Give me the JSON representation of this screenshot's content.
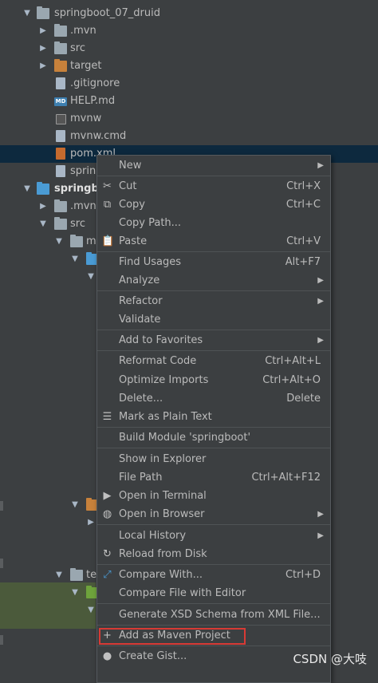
{
  "tree": {
    "items": [
      {
        "label": "springboot_07_druid"
      },
      {
        "label": ".mvn"
      },
      {
        "label": "src"
      },
      {
        "label": "target"
      },
      {
        "label": ".gitignore"
      },
      {
        "label": "HELP.md",
        "badge": "MD"
      },
      {
        "label": "mvnw"
      },
      {
        "label": "mvnw.cmd"
      },
      {
        "label": "pom.xml"
      },
      {
        "label": "sprin"
      },
      {
        "label": "springbo"
      },
      {
        "label": ".mvn"
      },
      {
        "label": "src"
      },
      {
        "label": "m"
      },
      {
        "label": "te"
      }
    ]
  },
  "menu": {
    "items": [
      {
        "label": "New"
      },
      {
        "label": "Cut",
        "shortcut": "Ctrl+X"
      },
      {
        "label": "Copy",
        "shortcut": "Ctrl+C"
      },
      {
        "label": "Copy Path..."
      },
      {
        "label": "Paste",
        "shortcut": "Ctrl+V"
      },
      {
        "label": "Find Usages",
        "shortcut": "Alt+F7"
      },
      {
        "label": "Analyze"
      },
      {
        "label": "Refactor"
      },
      {
        "label": "Validate"
      },
      {
        "label": "Add to Favorites"
      },
      {
        "label": "Reformat Code",
        "shortcut": "Ctrl+Alt+L"
      },
      {
        "label": "Optimize Imports",
        "shortcut": "Ctrl+Alt+O"
      },
      {
        "label": "Delete...",
        "shortcut": "Delete"
      },
      {
        "label": "Mark as Plain Text"
      },
      {
        "label": "Build Module 'springboot'"
      },
      {
        "label": "Show in Explorer"
      },
      {
        "label": "File Path",
        "shortcut": "Ctrl+Alt+F12"
      },
      {
        "label": "Open in Terminal"
      },
      {
        "label": "Open in Browser"
      },
      {
        "label": "Local History"
      },
      {
        "label": "Reload from Disk"
      },
      {
        "label": "Compare With...",
        "shortcut": "Ctrl+D"
      },
      {
        "label": "Compare File with Editor"
      },
      {
        "label": "Generate XSD Schema from XML File..."
      },
      {
        "label": "Add as Maven Project"
      },
      {
        "label": "Create Gist..."
      }
    ]
  },
  "watermark": "CSDN @大吱",
  "colors": {
    "selection": "#0d293e",
    "highlight_box": "#d83a35",
    "menu_bg": "#3c3f41"
  }
}
